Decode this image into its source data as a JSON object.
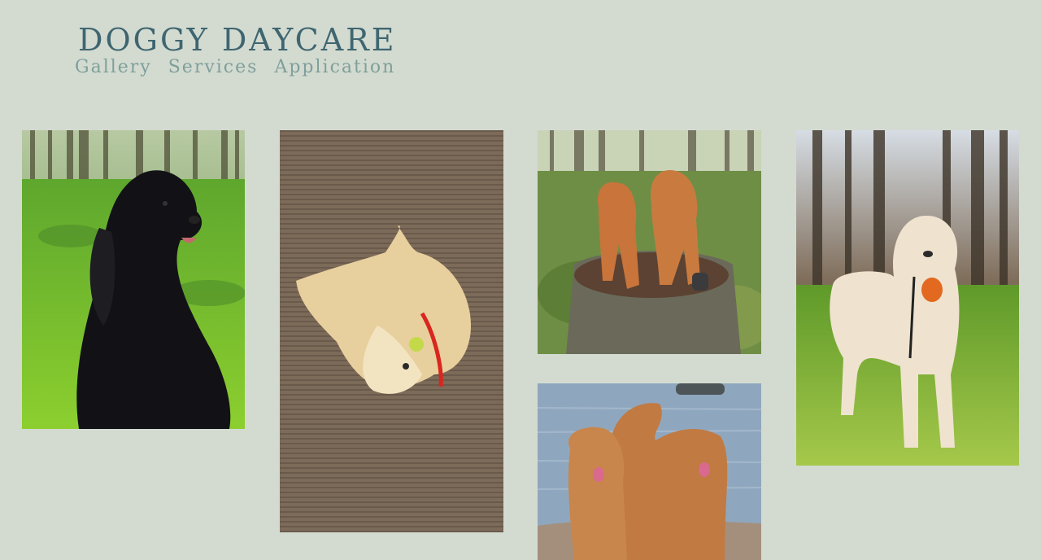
{
  "site": {
    "title": "DOGGY DAYCARE"
  },
  "nav": {
    "items": [
      {
        "label": "Gallery"
      },
      {
        "label": "Services"
      },
      {
        "label": "Application"
      }
    ]
  },
  "gallery": {
    "photos": [
      {
        "subject": "black cocker spaniel sitting in mossy forest"
      },
      {
        "subject": "golden retriever lying on carpet with red toy"
      },
      {
        "subject": "two toller dogs standing on tree stump in forest"
      },
      {
        "subject": "two toller dogs at the lake shore"
      },
      {
        "subject": "cream golden retriever holding orange ball toy in forest"
      }
    ]
  }
}
